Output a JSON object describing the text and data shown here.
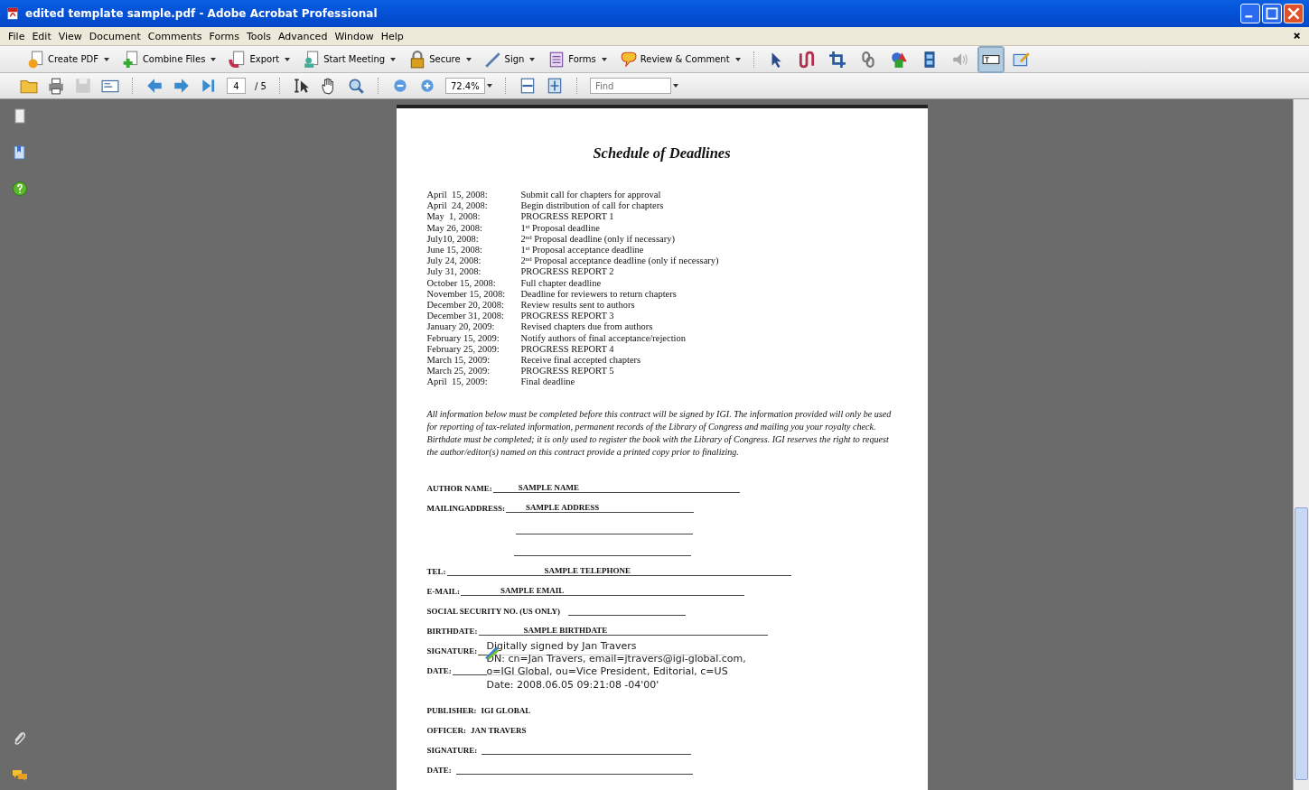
{
  "window": {
    "title": "edited template sample.pdf - Adobe Acrobat Professional"
  },
  "menu": [
    "File",
    "Edit",
    "View",
    "Document",
    "Comments",
    "Forms",
    "Tools",
    "Advanced",
    "Window",
    "Help"
  ],
  "task_buttons": [
    {
      "label": "Create PDF"
    },
    {
      "label": "Combine Files"
    },
    {
      "label": "Export"
    },
    {
      "label": "Start Meeting"
    },
    {
      "label": "Secure"
    },
    {
      "label": "Sign"
    },
    {
      "label": "Forms"
    },
    {
      "label": "Review & Comment"
    }
  ],
  "tools": [
    {
      "selected": false
    },
    {
      "selected": false
    },
    {
      "selected": false
    },
    {
      "selected": false
    },
    {
      "selected": false
    },
    {
      "selected": false
    },
    {
      "selected": false
    },
    {
      "selected": true
    },
    {
      "selected": false
    }
  ],
  "navigation": {
    "page": "4",
    "page_count": "/ 5",
    "zoom": "72.4%",
    "find_placeholder": "Find"
  },
  "document": {
    "title": "Schedule of Deadlines",
    "deadlines": [
      {
        "date": "April  15, 2008:",
        "task": "Submit call for chapters for approval"
      },
      {
        "date": "April  24, 2008:",
        "task": "Begin distribution of call for chapters"
      },
      {
        "date": "May  1, 2008:",
        "task": "PROGRESS REPORT 1"
      },
      {
        "date": "May 26, 2008:",
        "task": "1$^{st}$ Proposal deadline"
      },
      {
        "date": "July10, 2008:",
        "task": "2$^{nd}$ Proposal deadline (only if necessary)"
      },
      {
        "date": "June 15, 2008:",
        "task": "1$^{st}$ Proposal acceptance deadline"
      },
      {
        "date": "July 24, 2008:",
        "task": "2$^{nd}$ Proposal acceptance deadline (only if necessary)"
      },
      {
        "date": "July 31, 2008:",
        "task": "PROGRESS REPORT 2"
      },
      {
        "date": "October 15, 2008:",
        "task": "Full chapter deadline"
      },
      {
        "date": "November 15, 2008:",
        "task": "Deadline for reviewers to return chapters"
      },
      {
        "date": "December 20, 2008:",
        "task": "Review results sent to authors"
      },
      {
        "date": "December 31, 2008:",
        "task": "PROGRESS REPORT 3"
      },
      {
        "date": "January 20, 2009:",
        "task": "Revised chapters due from authors"
      },
      {
        "date": "February 15, 2009:",
        "task": "Notify authors of final acceptance/rejection"
      },
      {
        "date": "February 25, 2009:",
        "task": "PROGRESS REPORT 4"
      },
      {
        "date": "March 15, 2009:",
        "task": "Receive final accepted chapters"
      },
      {
        "date": "March 25, 2009:",
        "task": "PROGRESS REPORT 5"
      },
      {
        "date": "April  15, 2009:",
        "task": "Final deadline"
      }
    ],
    "notice": "All information below must be completed before this contract will be signed by IGI. The information provided will only be used for reporting of tax-related information, permanent records of the Library of Congress and mailing you your royalty check. Birthdate must be completed; it is only used to register the book with the Library of Congress. IGI reserves the right to request the author/editor(s) named on this contract provide a printed copy prior to finalizing.",
    "fields": [
      {
        "kind": "line",
        "label": "AUTHOR NAME:",
        "value": "SAMPLE NAME"
      },
      {
        "kind": "line",
        "label": "MAILINGADDRESS:",
        "value": "SAMPLE ADDRESS"
      },
      {
        "kind": "blank"
      },
      {
        "kind": "blank"
      },
      {
        "kind": "line",
        "label": "TEL:",
        "value": "SAMPLE TELEPHONE"
      },
      {
        "kind": "line",
        "label": "E-MAIL:",
        "value": "SAMPLE EMAIL"
      },
      {
        "kind": "line",
        "label": "SOCIAL SECURITY NO. (US ONLY)"
      },
      {
        "kind": "line",
        "label": "BIRTHDATE:",
        "value": "SAMPLE BIRTHDATE"
      },
      {
        "kind": "signature",
        "label": "SIGNATURE:",
        "signature": [
          "Digitally signed by Jan Travers",
          "DN: cn=Jan Travers, email=jtravers@igi-global.com,",
          "o=IGI Global, ou=Vice President, Editorial, c=US",
          "Date: 2008.06.05 09:21:08 -04'00'"
        ]
      },
      {
        "kind": "line",
        "label": "DATE:"
      },
      {
        "kind": "text",
        "label": "PUBLISHER:",
        "value": "IGI GLOBAL"
      },
      {
        "kind": "text",
        "label": "OFFICER:",
        "value": "JAN TRAVERS"
      },
      {
        "kind": "line",
        "label": "SIGNATURE:"
      },
      {
        "kind": "line",
        "label": "DATE:"
      }
    ]
  }
}
